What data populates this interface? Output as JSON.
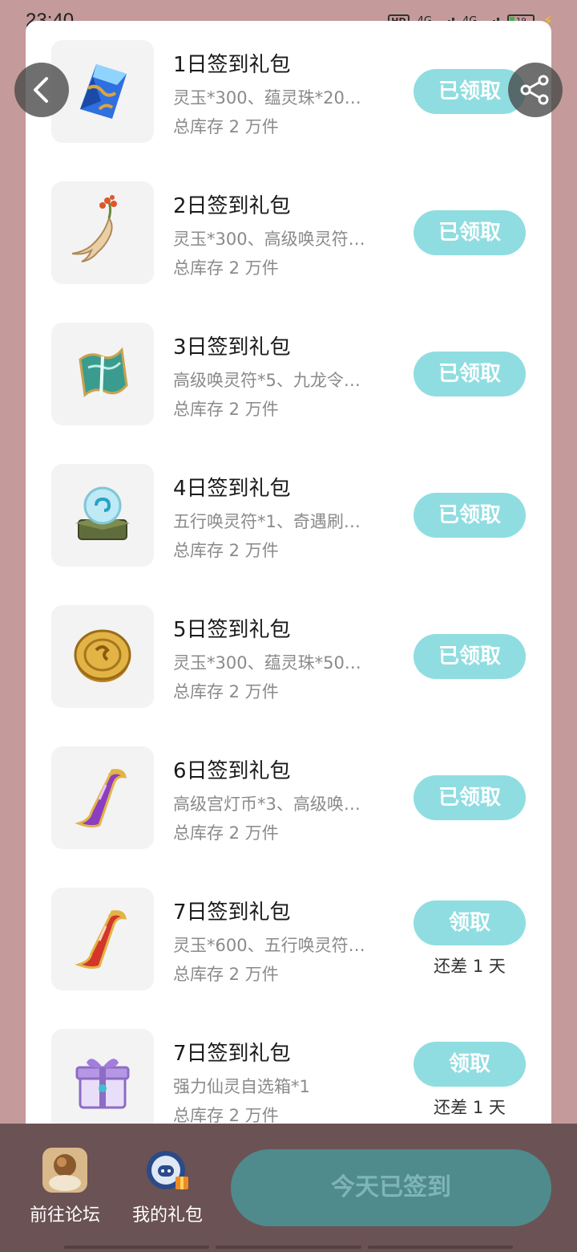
{
  "status_bar": {
    "time": "23:40",
    "hd_label": "HD",
    "net_label_1": "4G",
    "net_label_2": "4G",
    "battery_level": "19"
  },
  "gifts": [
    {
      "title": "1日签到礼包",
      "desc": "灵玉*300、蕴灵珠*20…",
      "stock": "总库存 2 万件",
      "button": "已领取",
      "remain": "",
      "icon": "blue-crystal-icon"
    },
    {
      "title": "2日签到礼包",
      "desc": "灵玉*300、高级唤灵符…",
      "stock": "总库存 2 万件",
      "button": "已领取",
      "remain": "",
      "icon": "ginseng-root-icon"
    },
    {
      "title": "3日签到礼包",
      "desc": "高级唤灵符*5、九龙令…",
      "stock": "总库存 2 万件",
      "button": "已领取",
      "remain": "",
      "icon": "jade-talisman-icon"
    },
    {
      "title": "4日签到礼包",
      "desc": "五行唤灵符*1、奇遇刷…",
      "stock": "总库存 2 万件",
      "button": "已领取",
      "remain": "",
      "icon": "spirit-orb-icon"
    },
    {
      "title": "5日签到礼包",
      "desc": "灵玉*300、蕴灵珠*50…",
      "stock": "总库存 2 万件",
      "button": "已领取",
      "remain": "",
      "icon": "gold-coin-icon"
    },
    {
      "title": "6日签到礼包",
      "desc": "高级宫灯币*3、高级唤…",
      "stock": "总库存 2 万件",
      "button": "已领取",
      "remain": "",
      "icon": "purple-scroll-icon"
    },
    {
      "title": "7日签到礼包",
      "desc": "灵玉*600、五行唤灵符…",
      "stock": "总库存 2 万件",
      "button": "领取",
      "remain": "还差 1 天",
      "icon": "red-scroll-icon"
    },
    {
      "title": "7日签到礼包",
      "desc": "强力仙灵自选箱*1",
      "stock": "总库存 2 万件",
      "button": "领取",
      "remain": "还差 1 天",
      "icon": "gift-box-icon"
    }
  ],
  "bottom_bar": {
    "forum_label": "前往论坛",
    "my_gifts_label": "我的礼包",
    "signed_label": "今天已签到"
  },
  "colors": {
    "background": "#c49a9b",
    "claimed_button": "#8fdde1",
    "signed_button": "#4f8a8c",
    "bottom_bar": "#6b5254"
  }
}
